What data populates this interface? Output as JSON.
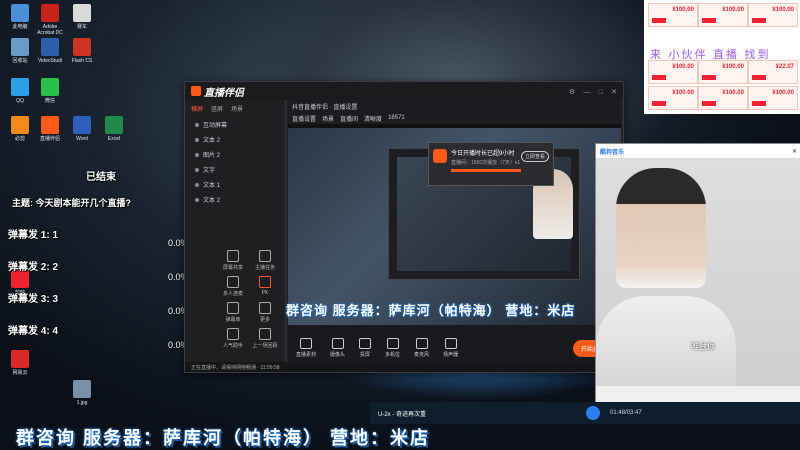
{
  "desktop": {
    "icons": [
      {
        "label": "此电脑",
        "color": "#4a8fd8"
      },
      {
        "label": "Adobe Acrobat DC",
        "color": "#c8221a"
      },
      {
        "label": "赛车",
        "color": "#dadada"
      },
      {
        "label": "回收站",
        "color": "#6a9ac8"
      },
      {
        "label": "VideoStudi",
        "color": "#2b5fa8"
      },
      {
        "label": "Flash CS",
        "color": "#cc3322"
      },
      {
        "label": "QQ",
        "color": "#2ba0e8"
      },
      {
        "label": "微信",
        "color": "#2bc04a"
      },
      {
        "label": "必剪",
        "color": "#f38a1a"
      },
      {
        "label": "直播伴侣",
        "color": "#ff5a1a"
      },
      {
        "label": "Word",
        "color": "#2b5fbb"
      },
      {
        "label": "Excel",
        "color": "#1f8a4a"
      },
      {
        "label": "剪映",
        "color": "#e23"
      },
      {
        "label": "网易云",
        "color": "#d92a2a"
      },
      {
        "label": "1.jpg",
        "color": "#7a8fa8"
      }
    ]
  },
  "overlay": {
    "ended": "已结束",
    "question": "主题: 今天剧本能开几个直播?",
    "lines": [
      {
        "label": "弹幕发 1: 1",
        "pct": "0.0%"
      },
      {
        "label": "弹幕发 2: 2",
        "pct": "0.0%"
      },
      {
        "label": "弹幕发 3: 3",
        "pct": "0.0%"
      },
      {
        "label": "弹幕发 4: 4",
        "pct": "0.0%"
      }
    ]
  },
  "app": {
    "logo": "直播伴侣",
    "window_title": "抖音直播伴侣 · 直播设置",
    "side_tabs": [
      "横屏",
      "竖屏",
      "场景"
    ],
    "scenes": [
      "互动屏幕",
      "文本 2",
      "图片 2",
      "文字",
      "文本 1",
      "文本 2"
    ],
    "tools": [
      {
        "label": "屏幕共享"
      },
      {
        "label": "主播任务"
      },
      {
        "label": "多人连麦"
      },
      {
        "label": "PK"
      },
      {
        "label": "弹幕库"
      },
      {
        "label": "更多"
      },
      {
        "label": "人气助手"
      },
      {
        "label": "上一场回顾"
      }
    ],
    "topbar": [
      "直播设置",
      "场景",
      "直播间",
      "清晰度",
      "18571"
    ],
    "bottom_buttons": [
      {
        "label": "直播素材"
      },
      {
        "label": "摄像头"
      },
      {
        "label": "投屏"
      },
      {
        "label": "多机位"
      },
      {
        "label": "麦克风"
      },
      {
        "label": "扬声器"
      }
    ],
    "go_live": "开始直播",
    "status": "正在直播中，请保持网络畅通 · 11:59:58"
  },
  "popup": {
    "title": "今日开播时长已超9小时",
    "subtitle": "直播间：1500次播放（7天）x1",
    "button": "立即查看"
  },
  "player": {
    "title": "酷狗音乐",
    "caption": "唯独你",
    "song": "U-2x - 奇迹再次重",
    "time": "01:48/03:47"
  },
  "coupons": {
    "amounts": [
      "¥100.00",
      "¥100.00",
      "¥100.00",
      "¥100.00",
      "¥100.00",
      "¥22.07",
      "¥100.00",
      "¥100.00",
      "¥100.00"
    ],
    "handwriting": "来 小伙伴 直播 找到"
  },
  "ticker": {
    "main": "群咨询  服务器：萨库河（帕特海）  营地：米店",
    "overlay": "群咨询  服务器：萨库河（帕特海）  营地：米店"
  }
}
